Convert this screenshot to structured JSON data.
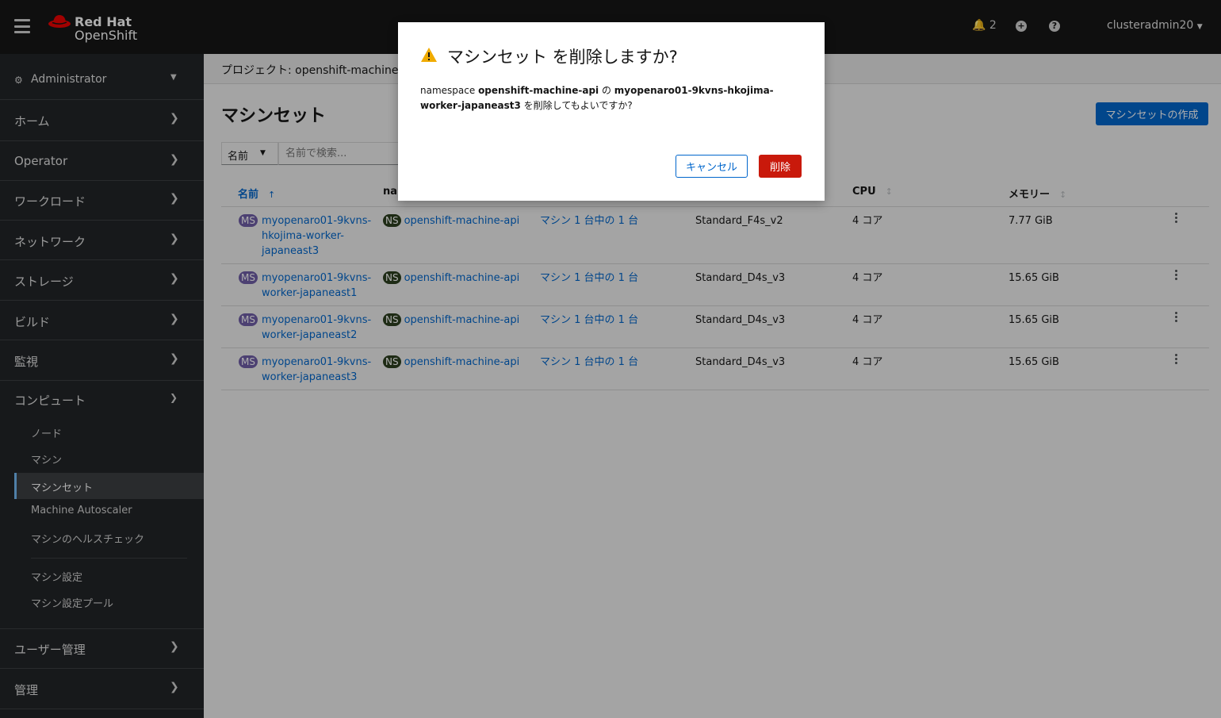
{
  "masthead": {
    "brand_line1": "Red Hat",
    "brand_line2": "OpenShift",
    "notification_count": "2",
    "user": "clusteradmin20"
  },
  "sidebar": {
    "perspective": "Administrator",
    "sections": [
      {
        "label": "ホーム"
      },
      {
        "label": "Operator"
      },
      {
        "label": "ワークロード"
      },
      {
        "label": "ネットワーク"
      },
      {
        "label": "ストレージ"
      },
      {
        "label": "ビルド"
      },
      {
        "label": "監視"
      },
      {
        "label": "コンピュート"
      },
      {
        "label": "ユーザー管理"
      },
      {
        "label": "管理"
      }
    ],
    "compute_items": [
      {
        "label": "ノード"
      },
      {
        "label": "マシン"
      },
      {
        "label": "マシンセット"
      },
      {
        "label": "Machine Autoscaler"
      },
      {
        "label": "マシンのヘルスチェック"
      },
      {
        "label": "マシン設定"
      },
      {
        "label": "マシン設定プール"
      }
    ]
  },
  "main": {
    "project_label": "プロジェクト: openshift-machine-a",
    "page_title": "マシンセット",
    "create_button": "マシンセットの作成",
    "filter_type": "名前",
    "filter_placeholder": "名前で検索...",
    "columns": {
      "name": "名前",
      "namespace": "nar",
      "cpu": "CPU",
      "memory": "メモリー"
    },
    "rows": [
      {
        "badge": "MS",
        "name": "myopenaro01-9kvns-hkojima-worker-japaneast3",
        "ns_badge": "NS",
        "namespace": "openshift-machine-api",
        "machines": "マシン 1 台中の 1 台",
        "type": "Standard_F4s_v2",
        "cpu": "4 コア",
        "memory": "7.77 GiB"
      },
      {
        "badge": "MS",
        "name": "myopenaro01-9kvns-worker-japaneast1",
        "ns_badge": "NS",
        "namespace": "openshift-machine-api",
        "machines": "マシン 1 台中の 1 台",
        "type": "Standard_D4s_v3",
        "cpu": "4 コア",
        "memory": "15.65 GiB"
      },
      {
        "badge": "MS",
        "name": "myopenaro01-9kvns-worker-japaneast2",
        "ns_badge": "NS",
        "namespace": "openshift-machine-api",
        "machines": "マシン 1 台中の 1 台",
        "type": "Standard_D4s_v3",
        "cpu": "4 コア",
        "memory": "15.65 GiB"
      },
      {
        "badge": "MS",
        "name": "myopenaro01-9kvns-worker-japaneast3",
        "ns_badge": "NS",
        "namespace": "openshift-machine-api",
        "machines": "マシン 1 台中の 1 台",
        "type": "Standard_D4s_v3",
        "cpu": "4 コア",
        "memory": "15.65 GiB"
      }
    ]
  },
  "modal": {
    "title": "マシンセット を削除しますか?",
    "body_prefix": "namespace ",
    "body_namespace": "openshift-machine-api",
    "body_of": " の ",
    "body_name": "myopenaro01-9kvns-hkojima-worker-japaneast3",
    "body_suffix": " を削除してもよいですか?",
    "cancel_label": "キャンセル",
    "delete_label": "削除"
  },
  "colors": {
    "masthead": "#151515",
    "sidebar": "#212427",
    "primary": "#0066cc",
    "danger": "#c9190b",
    "warning": "#f0ab00",
    "ms_badge": "#6f5ea7",
    "ns_badge": "#2c3e1e"
  }
}
